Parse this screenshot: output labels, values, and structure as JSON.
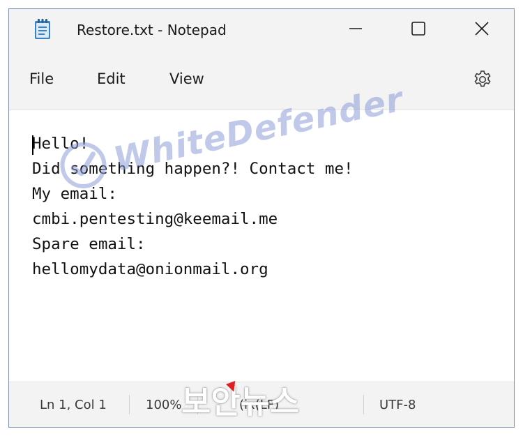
{
  "titlebar": {
    "title": "Restore.txt - Notepad",
    "icons": {
      "app": "notepad-icon",
      "minimize": "minimize-icon",
      "maximize": "maximize-icon",
      "close": "close-icon"
    }
  },
  "menubar": {
    "items": [
      {
        "label": "File"
      },
      {
        "label": "Edit"
      },
      {
        "label": "View"
      }
    ],
    "settings_icon": "gear-icon"
  },
  "editor": {
    "lines": [
      "Hello!",
      "Did something happen?! Contact me!",
      "My email:",
      "cmbi.pentesting@keemail.me",
      "Spare email:",
      "hellomydata@onionmail.org"
    ]
  },
  "statusbar": {
    "position": "Ln 1, Col 1",
    "zoom": "100%",
    "line_ending": "(ix(LF)",
    "encoding": "UTF-8"
  },
  "overlays": {
    "watermark": "WhiteDefender",
    "news_logo": "보안뉴스"
  },
  "colors": {
    "chrome_bg": "#f3f3f3",
    "editor_bg": "#ffffff",
    "watermark": "#8d9dd8",
    "news_accent": "#e02020"
  }
}
